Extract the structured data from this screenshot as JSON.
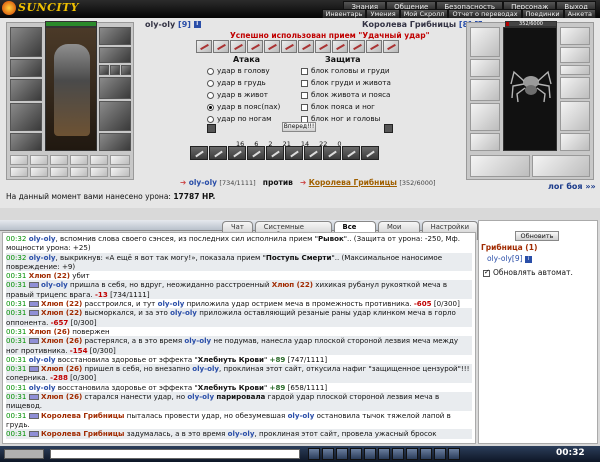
{
  "app": {
    "logo_text": "SUNCITY"
  },
  "top_menu": [
    "Знания",
    "Общение",
    "Безопасность",
    "Персонаж",
    "Выход"
  ],
  "sub_menu": [
    "Инвентарь",
    "Умения",
    "Мой Скролл",
    "Отчет о переводах",
    "Поединки",
    "Анкета"
  ],
  "fight": {
    "player_name": "oly-oly",
    "player_level": "[9]",
    "enemy_name": "Королева Грибницы",
    "enemy_level": "[8]",
    "player_hp_fill": 1.0,
    "enemy_hp_text": "352/6000",
    "enemy_hp_fill": 0.06,
    "success_message": "Успешно использован прием \"Удачный удар\"",
    "attack_header": "Атака",
    "defense_header": "Защита",
    "attack_options": [
      "удар в голову",
      "удар в грудь",
      "удар в живот",
      "удар в пояс(пах)",
      "удар по ногам"
    ],
    "attack_selected_index": 3,
    "defense_options": [
      "блок головы и груди",
      "блок груди и живота",
      "блок живота и пояса",
      "блок пояса и ног",
      "блок ног и головы"
    ],
    "forward_button": "Вперед!!!",
    "stats": [
      "16",
      "6",
      "2",
      "21",
      "14",
      "22",
      "0"
    ],
    "versus_player": "oly-oly",
    "versus_player_hp": "[734/1111]",
    "versus_word": "против",
    "versus_enemy": "Королева Грибницы",
    "versus_enemy_hp": "[352/6000]",
    "damage_label": "На данный момент вами нанесено урона:",
    "damage_value": "17787 HP.",
    "fight_log_link": "лог боя »»"
  },
  "chat": {
    "tabs": [
      "Чат",
      "Системные сообщения",
      "Все логи",
      "Мои логи",
      "Настройки"
    ],
    "active_tab_index": 2,
    "lines": [
      {
        "time": "00:32",
        "parts": [
          [
            "u",
            "oly-oly"
          ],
          [
            "n",
            ", вспомнив слова своего сэнсея, из последних сил исполнила прием \""
          ],
          [
            "b",
            "Рывок"
          ],
          [
            "n",
            "\".. (Защита от урона: -250, Мф. мощности урона: +25)"
          ]
        ]
      },
      {
        "time": "00:32",
        "parts": [
          [
            "u",
            "oly-oly"
          ],
          [
            "n",
            ", выкрикнув: «А ещё я вот так могу!», показала прием \""
          ],
          [
            "b",
            "Поступь Смерти"
          ],
          [
            "n",
            "\".. (Максимальное наносимое повреждение: +9)"
          ]
        ]
      },
      {
        "time": "00:31",
        "parts": [
          [
            "m",
            "Хлюп (22)"
          ],
          [
            "n",
            " убит"
          ]
        ]
      },
      {
        "time": "00:31",
        "mark": true,
        "parts": [
          [
            "u",
            "oly-oly"
          ],
          [
            "n",
            " пришла в себя, но вдруг, неожиданно расстроенный "
          ],
          [
            "m",
            "Хлюп (22)"
          ],
          [
            "n",
            " хихикая рубанул рукояткой меча в правый трицепс врага. "
          ],
          [
            "dmg",
            "-13"
          ],
          [
            "n",
            " [734/1111]"
          ]
        ]
      },
      {
        "time": "00:31",
        "mark": true,
        "parts": [
          [
            "m",
            "Хлюп (22)"
          ],
          [
            "n",
            " расстроился, и тут "
          ],
          [
            "u",
            "oly-oly"
          ],
          [
            "n",
            " приложила удар острием меча в промежность противника. "
          ],
          [
            "dmg",
            "-605"
          ],
          [
            "n",
            " [0/300]"
          ]
        ]
      },
      {
        "time": "00:31",
        "mark": true,
        "parts": [
          [
            "m",
            "Хлюп (22)"
          ],
          [
            "n",
            " высморкался, и за это "
          ],
          [
            "u",
            "oly-oly"
          ],
          [
            "n",
            " приложила оставляющий резаные раны удар клинком меча в горло оппонента. "
          ],
          [
            "dmg",
            "-657"
          ],
          [
            "n",
            " [0/300]"
          ]
        ]
      },
      {
        "time": "00:31",
        "parts": [
          [
            "m",
            "Хлюп (26)"
          ],
          [
            "n",
            " повержен"
          ]
        ]
      },
      {
        "time": "00:31",
        "mark": true,
        "parts": [
          [
            "m",
            "Хлюп (26)"
          ],
          [
            "n",
            " растерялся, а в это время "
          ],
          [
            "u",
            "oly-oly"
          ],
          [
            "n",
            " не подумав, нанесла удар плоской стороной лезвия меча между ног противника. "
          ],
          [
            "dmg",
            "-154"
          ],
          [
            "n",
            " [0/300]"
          ]
        ]
      },
      {
        "time": "00:31",
        "parts": [
          [
            "u",
            "oly-oly"
          ],
          [
            "n",
            " восстановила здоровье от эффекта \""
          ],
          [
            "b",
            "Хлебнуть Крови"
          ],
          [
            "n",
            "\" "
          ],
          [
            "heal",
            "+89"
          ],
          [
            "n",
            " [747/1111]"
          ]
        ]
      },
      {
        "time": "00:31",
        "mark": true,
        "parts": [
          [
            "m",
            "Хлюп (26)"
          ],
          [
            "n",
            " пришел в себя, но внезапно "
          ],
          [
            "u",
            "oly-oly"
          ],
          [
            "n",
            ", проклиная этот сайт, откусила нафиг \"защищенное цензурой\"!!! соперника. "
          ],
          [
            "dmg",
            "-288"
          ],
          [
            "n",
            " [0/300]"
          ]
        ]
      },
      {
        "time": "00:31",
        "parts": [
          [
            "u",
            "oly-oly"
          ],
          [
            "n",
            " восстановила здоровье от эффекта \""
          ],
          [
            "b",
            "Хлебнуть Крови"
          ],
          [
            "n",
            "\" "
          ],
          [
            "heal",
            "+89"
          ],
          [
            "n",
            " [658/1111]"
          ]
        ]
      },
      {
        "time": "00:31",
        "mark": true,
        "parts": [
          [
            "m",
            "Хлюп (26)"
          ],
          [
            "n",
            " старался нанести удар, но "
          ],
          [
            "u",
            "oly-oly"
          ],
          [
            "n",
            " "
          ],
          [
            "b",
            "парировала"
          ],
          [
            "n",
            " гардой удар плоской стороной лезвия меча в пищевод."
          ]
        ]
      },
      {
        "time": "00:31",
        "mark": true,
        "parts": [
          [
            "m",
            "Королева Грибницы"
          ],
          [
            "n",
            " пыталась провести удар, но обезумевшая "
          ],
          [
            "u",
            "oly-oly"
          ],
          [
            "n",
            " остановила тычок тяжелой лапой в грудь."
          ]
        ]
      },
      {
        "time": "00:31",
        "mark": true,
        "parts": [
          [
            "m",
            "Королева Грибницы"
          ],
          [
            "n",
            " задумалась, а в это время "
          ],
          [
            "u",
            "oly-oly"
          ],
          [
            "n",
            ", проклиная этот сайт, провела ужасный бросок"
          ]
        ]
      }
    ]
  },
  "right_panel": {
    "refresh_button": "Обновить",
    "title": "Грибница (1)",
    "user": "oly-oly[9]",
    "auto_refresh_label": "Обновлять автомат."
  },
  "bottom": {
    "clock": "00:32"
  }
}
